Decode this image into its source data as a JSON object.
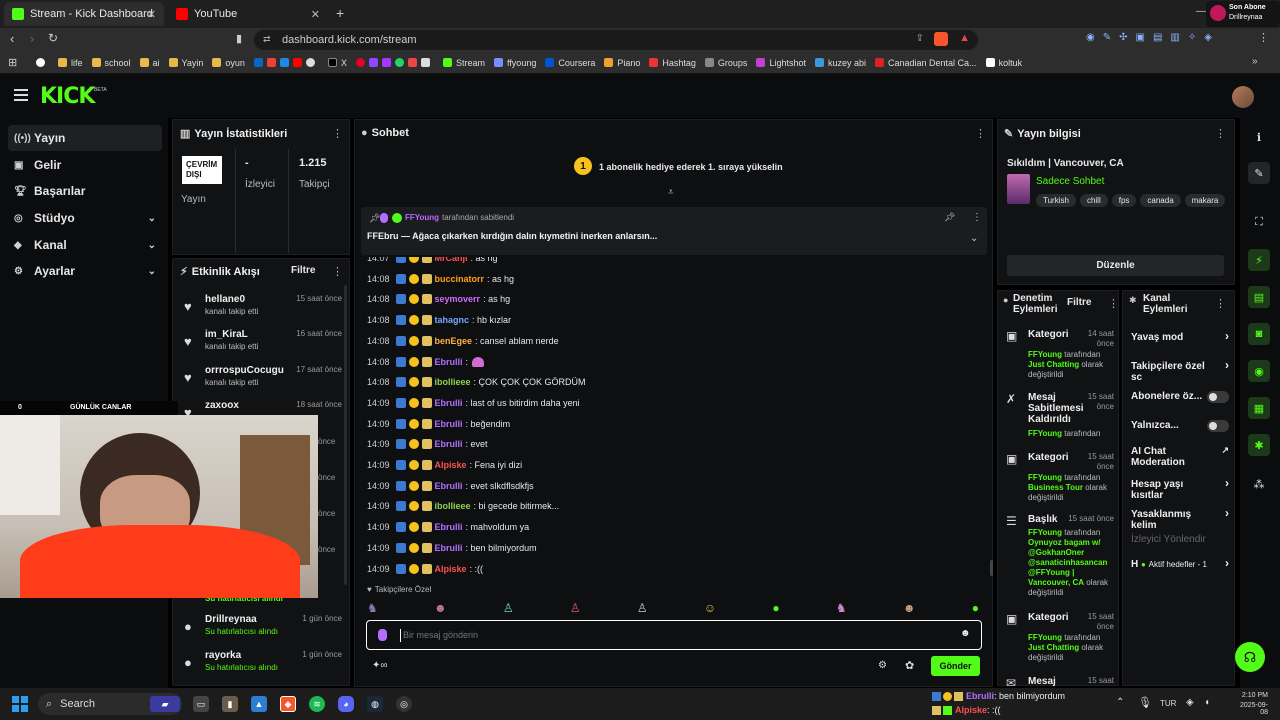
{
  "browser": {
    "tabs": [
      {
        "label": "Stream - Kick Dashboard",
        "active": true,
        "icon": "kick-icon"
      },
      {
        "label": "YouTube",
        "active": false,
        "icon": "youtube-icon"
      }
    ],
    "url": "dashboard.kick.com/stream",
    "bookmarks": [
      "life",
      "school",
      "ai",
      "Yayin",
      "oyun",
      "X",
      "Stream",
      "ffyoung",
      "Coursera",
      "Piano",
      "Hashtag",
      "Groups",
      "Lightshot",
      "kuzey abi",
      "Canadian Dental Ca...",
      "koltuk"
    ],
    "notification": {
      "title": "Son Abone",
      "name": "Drillreynaa"
    }
  },
  "header": {
    "logo": "KICK",
    "beta": "BETA"
  },
  "nav": {
    "items": [
      {
        "label": "Yayın",
        "icon": "broadcast-icon",
        "active": true
      },
      {
        "label": "Gelir",
        "icon": "revenue-icon"
      },
      {
        "label": "Başarılar",
        "icon": "trophy-icon"
      },
      {
        "label": "Stüdyo",
        "icon": "studio-icon",
        "expand": true
      },
      {
        "label": "Kanal",
        "icon": "channel-icon",
        "expand": true
      },
      {
        "label": "Ayarlar",
        "icon": "settings-icon",
        "expand": true
      }
    ]
  },
  "stats": {
    "title": "Yayın İstatistikleri",
    "status_badge": "ÇEVRİM DIŞI",
    "status_label": "Yayın",
    "viewers_value": "-",
    "viewers_label": "İzleyici",
    "followers_value": "1.215",
    "followers_label": "Takipçi"
  },
  "activity": {
    "title": "Etkinlik Akışı",
    "filter": "Filtre",
    "items": [
      {
        "name": "hellane0",
        "sub": "kanalı takip etti",
        "time": "15 saat önce",
        "icon": "heart-icon"
      },
      {
        "name": "im_KiraL",
        "sub": "kanalı takip etti",
        "time": "16 saat önce",
        "icon": "heart-icon"
      },
      {
        "name": "orrrospuCocugu",
        "sub": "kanalı takip etti",
        "time": "17 saat önce",
        "icon": "heart-icon"
      },
      {
        "name": "zaxoox",
        "sub": "",
        "time": "18 saat önce",
        "icon": "heart-icon"
      },
      {
        "name": "Drillreynaa",
        "sub": "Su hatırlatıcısı alındı",
        "time": "1 gün önce",
        "icon": "drop-icon"
      },
      {
        "name": "rayorka",
        "sub": "Su hatırlatıcısı alındı",
        "time": "1 gün önce",
        "icon": "drop-icon"
      }
    ],
    "partial_sub": "Su hatırlatıcısı alındı",
    "side_times": [
      "önce",
      "önce",
      "önce",
      "önce"
    ]
  },
  "overlay": {
    "left": "0",
    "right": "GÜNLÜK CANLAR"
  },
  "chat": {
    "title": "Sohbet",
    "gift_banner": "1 abonelik hediye ederek 1. sıraya yükselin",
    "gift_rank": "1",
    "pinned_by": "FFYoung",
    "pinned_suffix": "tarafından sabitlendi",
    "pinned_message": "FFEbru — Ağaca çıkarken kırdığın dalın kıymetini inerken anlarsın...",
    "messages": [
      {
        "time": "14:07",
        "user": "MrCanji",
        "color": "#ff4f4f",
        "text": ": as hg"
      },
      {
        "time": "14:08",
        "user": "buccinatorr",
        "color": "#ff9f1a",
        "text": ": as hg"
      },
      {
        "time": "14:08",
        "user": "seymoverr",
        "color": "#d36bff",
        "text": ": as hg"
      },
      {
        "time": "14:08",
        "user": "tahagnc",
        "color": "#6fa9ff",
        "text": ": hb kızlar"
      },
      {
        "time": "14:08",
        "user": "benEgee",
        "color": "#ffb23f",
        "text": ": cansel ablam nerde"
      },
      {
        "time": "14:08",
        "user": "Ebrulli",
        "color": "#b66dff",
        "text": ": "
      },
      {
        "time": "14:08",
        "user": "ibollieee",
        "color": "#8fd14f",
        "text": ": ÇOK ÇOK ÇOK GÖRDÜM"
      },
      {
        "time": "14:09",
        "user": "Ebrulli",
        "color": "#b66dff",
        "text": ": last of us bitirdim daha yeni"
      },
      {
        "time": "14:09",
        "user": "Ebrulli",
        "color": "#b66dff",
        "text": ": beğendim"
      },
      {
        "time": "14:09",
        "user": "Ebrulli",
        "color": "#b66dff",
        "text": ": evet"
      },
      {
        "time": "14:09",
        "user": "Alpiske",
        "color": "#ff4f4f",
        "text": ": Fena iyi dizi"
      },
      {
        "time": "14:09",
        "user": "Ebrulli",
        "color": "#b66dff",
        "text": ": evet slkdflsdkfjs"
      },
      {
        "time": "14:09",
        "user": "ibollieee",
        "color": "#8fd14f",
        "text": ": bi gecede bitirmek..."
      },
      {
        "time": "14:09",
        "user": "Ebrulli",
        "color": "#b66dff",
        "text": ": mahvoldum ya"
      },
      {
        "time": "14:09",
        "user": "Ebrulli",
        "color": "#b66dff",
        "text": ": ben bilmiyordum"
      },
      {
        "time": "14:09",
        "user": "Alpiske",
        "color": "#ff4f4f",
        "text": ": :(("
      }
    ],
    "emote_section": "Takipçilere Özel",
    "input_placeholder": "Bir mesaj gönderin",
    "send": "Gönder"
  },
  "stream_info": {
    "title": "Yayın bilgisi",
    "stream_title": "Sıkıldım | Vancouver, CA",
    "category": "Sadece Sohbet",
    "tags": [
      "Turkish",
      "chill",
      "fps",
      "canada",
      "makara"
    ],
    "edit": "Düzenle"
  },
  "moderation": {
    "title": "Denetim Eylemleri",
    "filter": "Filtre",
    "items": [
      {
        "title": "Kategori",
        "time": "14 saat önce",
        "user": "FFYoung",
        "mid": "tarafından",
        "value": "Just Chatting",
        "suffix": "olarak değiştirildi",
        "icon": "category-icon"
      },
      {
        "title": "Mesaj Sabitlemesi Kaldırıldı",
        "time": "15 saat önce",
        "user": "FFYoung",
        "mid": "tarafından",
        "value": "",
        "suffix": "",
        "icon": "unpin-icon"
      },
      {
        "title": "Kategori",
        "time": "15 saat önce",
        "user": "FFYoung",
        "mid": "tarafından",
        "value": "Business Tour",
        "suffix": "olarak değiştirildi",
        "icon": "category-icon"
      },
      {
        "title": "Başlık",
        "time": "15 saat önce",
        "user": "FFYoung",
        "mid": "tarafından",
        "value": "Oynuyoz bagam w/ @GokhanOner @sanaticinhasancan @FFYoung | Vancouver, CA",
        "suffix": "olarak değiştirildi",
        "icon": "title-icon"
      },
      {
        "title": "Kategori",
        "time": "15 saat önce",
        "user": "FFYoung",
        "mid": "tarafından",
        "value": "Just Chatting",
        "suffix": "olarak değiştirildi",
        "icon": "category-icon"
      },
      {
        "title": "Mesaj",
        "time": "15 saat",
        "user": "",
        "mid": "",
        "value": "",
        "suffix": "",
        "icon": "message-icon"
      }
    ]
  },
  "channel_actions": {
    "title": "Kanal Eylemleri",
    "items": [
      {
        "label": "Yavaş mod",
        "type": "arrow"
      },
      {
        "label": "Takipçilere özel sc",
        "type": "arrow"
      },
      {
        "label": "Abonelere öz...",
        "type": "toggle"
      },
      {
        "label": "Yalnızca...",
        "type": "toggle"
      },
      {
        "label": "AI Chat Moderation",
        "type": "link"
      },
      {
        "label": "Hesap yaşı kısıtlar",
        "type": "arrow"
      },
      {
        "label": "Yasaklanmış kelim",
        "type": "arrow"
      },
      {
        "label": "İzleyici Yönlendir",
        "type": "disabled"
      },
      {
        "label": "Aktif hedefler - 1",
        "type": "arrow",
        "prefix": "H"
      }
    ]
  },
  "taskbar": {
    "search": "Search",
    "tray_lang": "TUR",
    "time": "2:10 PM",
    "date": "2025-09-08",
    "ticker": [
      {
        "user": "Ebrulli",
        "text": ": ben bilmiyordum",
        "color": "#b66dff"
      },
      {
        "user": "Alpiske",
        "text": ": :((",
        "color": "#ff4f4f"
      }
    ]
  },
  "colors": {
    "accent": "#53fc18",
    "bg": "#0b0c0e",
    "panel": "#111214"
  }
}
